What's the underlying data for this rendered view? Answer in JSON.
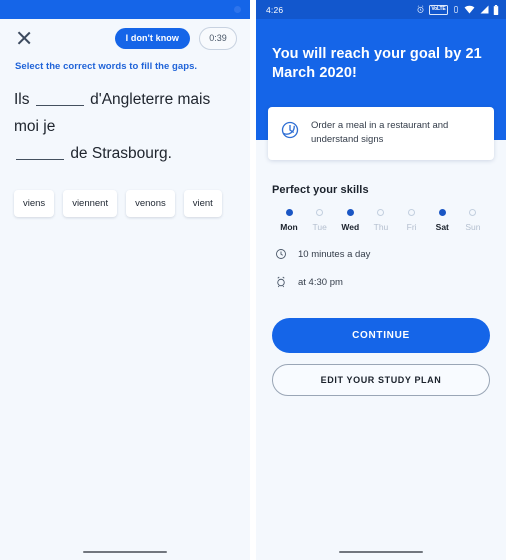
{
  "left_screen": {
    "status_bar": {
      "icon": "app-indicator-dot"
    },
    "top_bar": {
      "close_icon": "close-icon",
      "dont_know_label": "I don't know",
      "timer_value": "0:39"
    },
    "prompt": "Select the correct words to fill the gaps.",
    "sentence": {
      "part1": "Ils",
      "gap1": "",
      "part2": "d'Angleterre mais moi je",
      "gap2": "",
      "part3": "de Strasbourg."
    },
    "choices": [
      "viens",
      "viennent",
      "venons",
      "vient"
    ],
    "nav": {
      "pill": "home-gesture-pill"
    }
  },
  "right_screen": {
    "status_bar": {
      "time": "4:26",
      "icons": [
        "alarm-icon",
        "volte-icon",
        "vibrate-icon",
        "wifi-icon",
        "signal-icon",
        "battery-icon"
      ],
      "volte_label": "VoLTE"
    },
    "header": {
      "title": "You will reach your goal by 21 March 2020!"
    },
    "goal_card": {
      "icon": "goal-clock-icon",
      "text": "Order a meal in a restaurant and understand signs"
    },
    "skills": {
      "section_title": "Perfect your skills",
      "days": [
        {
          "label": "Mon",
          "selected": true
        },
        {
          "label": "Tue",
          "selected": false
        },
        {
          "label": "Wed",
          "selected": true
        },
        {
          "label": "Thu",
          "selected": false
        },
        {
          "label": "Fri",
          "selected": false
        },
        {
          "label": "Sat",
          "selected": true
        },
        {
          "label": "Sun",
          "selected": false
        }
      ]
    },
    "duration": {
      "icon": "clock-icon",
      "text": "10 minutes a day"
    },
    "reminder": {
      "icon": "alarm-clock-icon",
      "text": "at 4:30 pm"
    },
    "buttons": {
      "continue_label": "CONTINUE",
      "edit_plan_label": "EDIT YOUR STUDY PLAN"
    },
    "nav": {
      "pill": "home-gesture-pill"
    }
  },
  "colors": {
    "brand_blue": "#1565e8",
    "status_blue": "#1257cd",
    "screen_bg": "#f4f8fd",
    "prompt_blue": "#1f63d8",
    "dot_active": "#1a56c4",
    "dot_inactive": "#c3cfdf"
  }
}
